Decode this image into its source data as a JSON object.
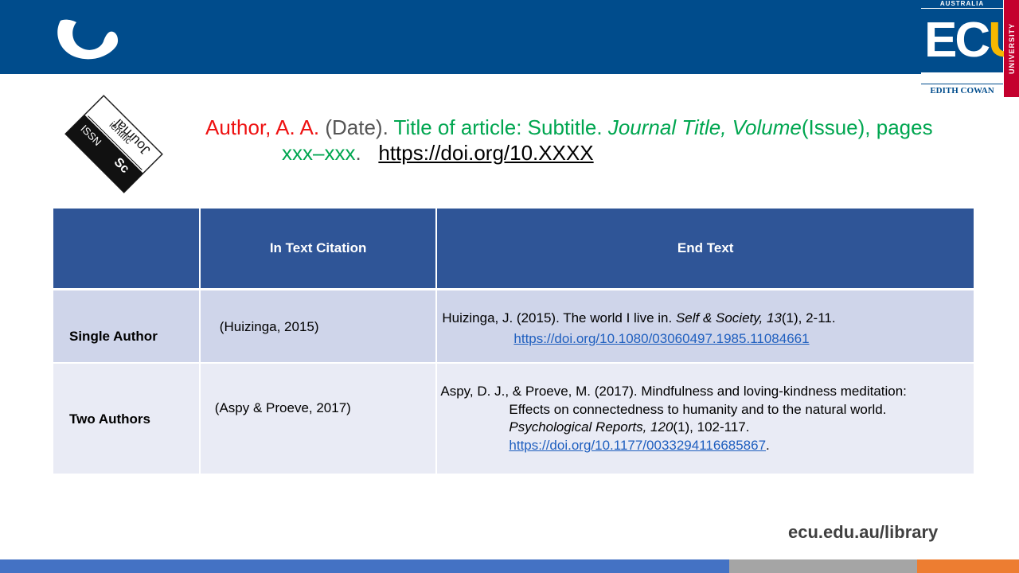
{
  "header": {
    "ecu_logo": {
      "top": "AUSTRALIA",
      "letters_ec": "EC",
      "letters_u": "U",
      "bottom": "EDITH COWAN",
      "side": "UNIVERSITY",
      "colors": {
        "blue": "#004c8c",
        "gold": "#f7b800",
        "red": "#c4002e"
      }
    }
  },
  "stamp": {
    "line_issn": "ISSN",
    "line_sc": "Sc",
    "line_ientific": "ientific",
    "line_journal": "Journal"
  },
  "citation": {
    "author": "Author, A. A.",
    "date": " (Date).",
    "title": " Title of article: Subtitle.",
    "journal": " Journal Title, Volume",
    "issue": "(Issue), pages",
    "pages": "xxx–xxx",
    "period": ".",
    "doi": "https://doi.org/10.XXXX"
  },
  "table": {
    "headers": [
      "",
      "In Text Citation",
      "End Text"
    ],
    "rows": [
      {
        "label": "Single Author",
        "intext": "(Huizinga,  2015)",
        "end_main": "Huizinga,  J. (2015). The world I live in. ",
        "end_journal": "Self & Society, 13",
        "end_rest": "(1), 2-11.",
        "doi": "https://doi.org/10.1080/03060497.1985.11084661"
      },
      {
        "label": "Two Authors",
        "intext": "(Aspy & Proeve, 2017)",
        "end_line1": "Aspy, D. J., & Proeve, M. (2017). Mindfulness and loving-kindness meditation:",
        "end_line2": "Effects on connectedness to humanity and to the natural world.",
        "end_journal": "Psychological Reports",
        "end_volume": ", 120",
        "end_rest": "(1), 102-117.",
        "doi": "https://doi.org/10.1177/0033294116685867",
        "doi_period": "."
      }
    ]
  },
  "footer": {
    "url": "ecu.edu.au/library",
    "bar_colors": [
      "#4472c4",
      "#a5a5a5",
      "#ed7d31"
    ]
  }
}
